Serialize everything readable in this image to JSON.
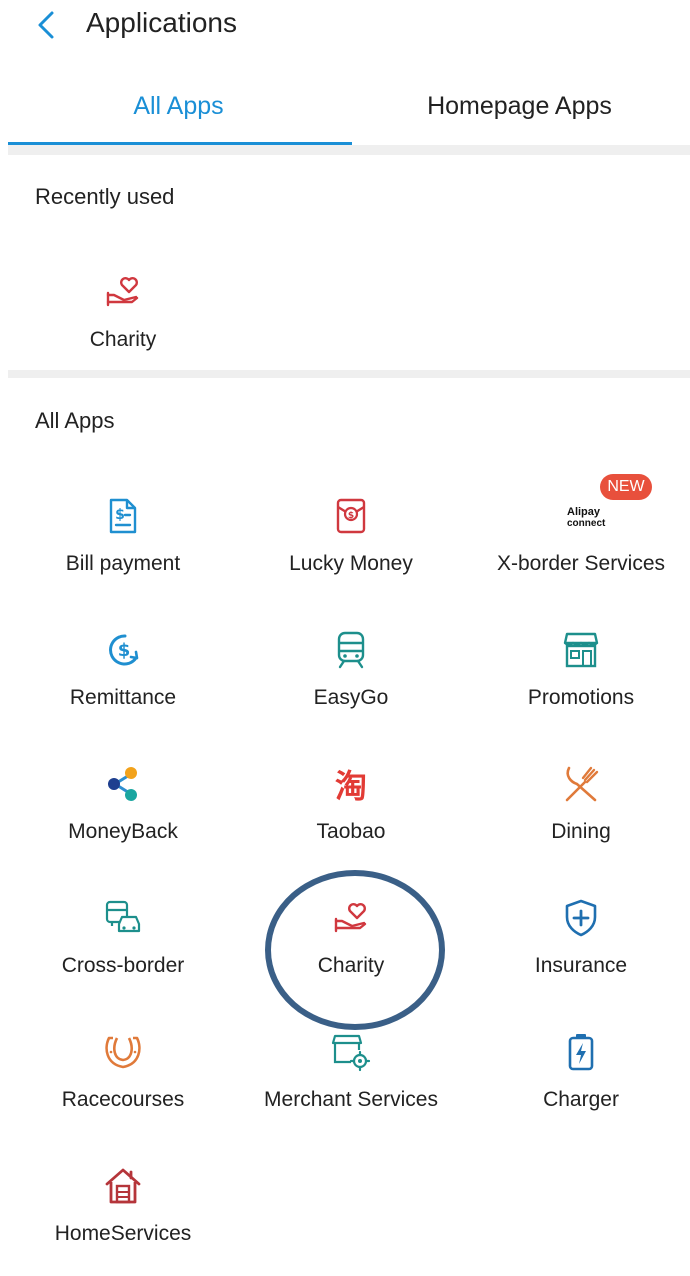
{
  "header": {
    "title": "Applications"
  },
  "tabs": [
    {
      "label": "All Apps",
      "active": true
    },
    {
      "label": "Homepage Apps",
      "active": false
    }
  ],
  "recent": {
    "title": "Recently used",
    "items": [
      {
        "label": "Charity",
        "icon": "charity-icon"
      }
    ]
  },
  "all_apps": {
    "title": "All Apps",
    "items": [
      {
        "label": "Bill payment",
        "icon": "bill-icon"
      },
      {
        "label": "Lucky Money",
        "icon": "red-envelope-icon"
      },
      {
        "label": "X-border Services",
        "icon": "alipay-connect-icon",
        "logo_text_1": "Alipay",
        "logo_text_2": "connect",
        "badge": "NEW"
      },
      {
        "label": "Remittance",
        "icon": "remittance-icon"
      },
      {
        "label": "EasyGo",
        "icon": "train-icon"
      },
      {
        "label": "Promotions",
        "icon": "store-icon"
      },
      {
        "label": "MoneyBack",
        "icon": "moneyback-icon"
      },
      {
        "label": "Taobao",
        "icon": "taobao-icon",
        "glyph": "淘"
      },
      {
        "label": "Dining",
        "icon": "dining-icon"
      },
      {
        "label": "Cross-border",
        "icon": "cross-border-icon"
      },
      {
        "label": "Charity",
        "icon": "charity-icon"
      },
      {
        "label": "Insurance",
        "icon": "shield-plus-icon"
      },
      {
        "label": "Racecourses",
        "icon": "horseshoe-icon"
      },
      {
        "label": "Merchant Services",
        "icon": "merchant-settings-icon"
      },
      {
        "label": "Charger",
        "icon": "battery-charge-icon"
      },
      {
        "label": "HomeServices",
        "icon": "house-icon"
      }
    ]
  },
  "colors": {
    "accent": "#1a8fd6",
    "badge": "#e8503c",
    "highlight_circle": "#3a5f87",
    "icon_blue": "#1f8fd0",
    "icon_red": "#d0383f",
    "icon_teal": "#1d8f8c",
    "icon_orange": "#e07a3a"
  }
}
